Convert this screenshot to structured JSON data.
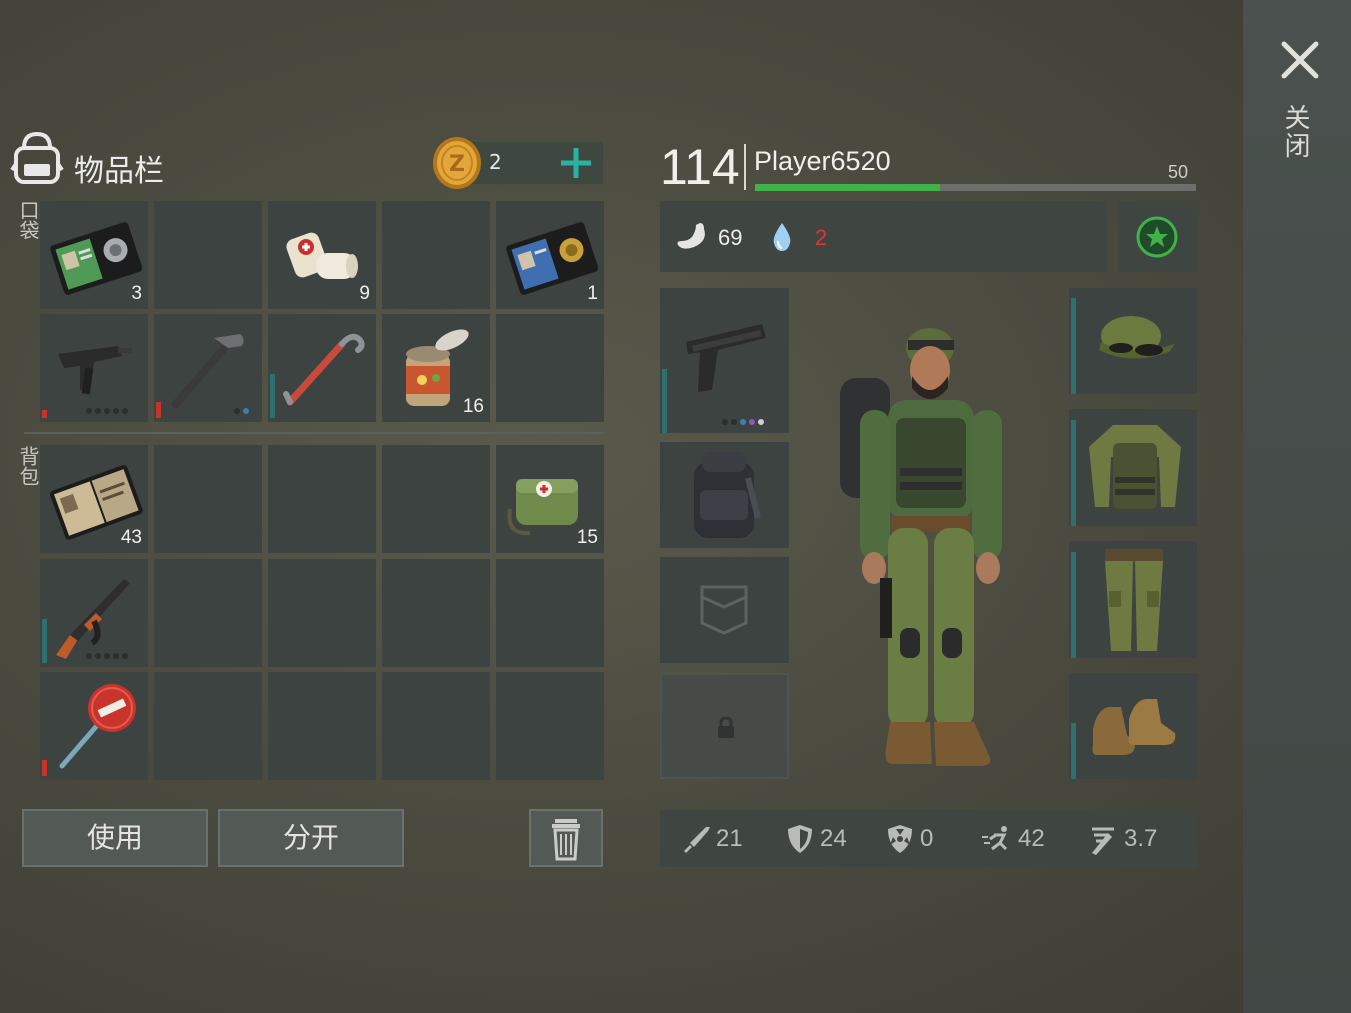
{
  "window": {
    "close_label": "关闭"
  },
  "inventory": {
    "title": "物品栏",
    "coins": "2",
    "pocket_label": "口袋",
    "backpack_label": "背包",
    "pocket_slots": [
      {
        "item": "police-id-wallet",
        "qty": "3"
      },
      {
        "item": "empty",
        "qty": ""
      },
      {
        "item": "bandage",
        "qty": "9"
      },
      {
        "item": "empty",
        "qty": ""
      },
      {
        "item": "detective-badge-wallet",
        "qty": "1"
      },
      {
        "item": "uzi-smg",
        "qty": ""
      },
      {
        "item": "hammer",
        "qty": ""
      },
      {
        "item": "crowbar",
        "qty": ""
      },
      {
        "item": "canned-food",
        "qty": "16"
      },
      {
        "item": "empty",
        "qty": ""
      }
    ],
    "backpack_slots": [
      {
        "item": "patrol-officer-id",
        "qty": "43"
      },
      {
        "item": "medical-bag",
        "qty": "15"
      },
      {
        "item": "ak47-rifle",
        "qty": ""
      },
      {
        "item": "stop-sign",
        "qty": ""
      }
    ],
    "use_button": "使用",
    "split_button": "分开"
  },
  "player": {
    "level": "114",
    "name": "Player6520",
    "xp_max": "50",
    "xp_progress": 0.42,
    "food": "69",
    "water": "2"
  },
  "equipment": {
    "weapon": "pistol",
    "backpack": "tactical-backpack",
    "pocket": "empty-pocket",
    "locked": "locked-slot",
    "head": "camo-cap-with-goggles",
    "torso": "camo-jacket-with-vest",
    "legs": "camo-pants",
    "feet": "tan-boots"
  },
  "stats": {
    "attack": "21",
    "defense": "24",
    "radiation": "0",
    "speed": "42",
    "stealth": "3.7"
  },
  "colors": {
    "accent_green": "#3fb34a",
    "plus_teal": "#2bb3a2",
    "water_red": "#e0342c",
    "durability_red": "#c8332c",
    "durability_teal": "#2e6f70"
  }
}
